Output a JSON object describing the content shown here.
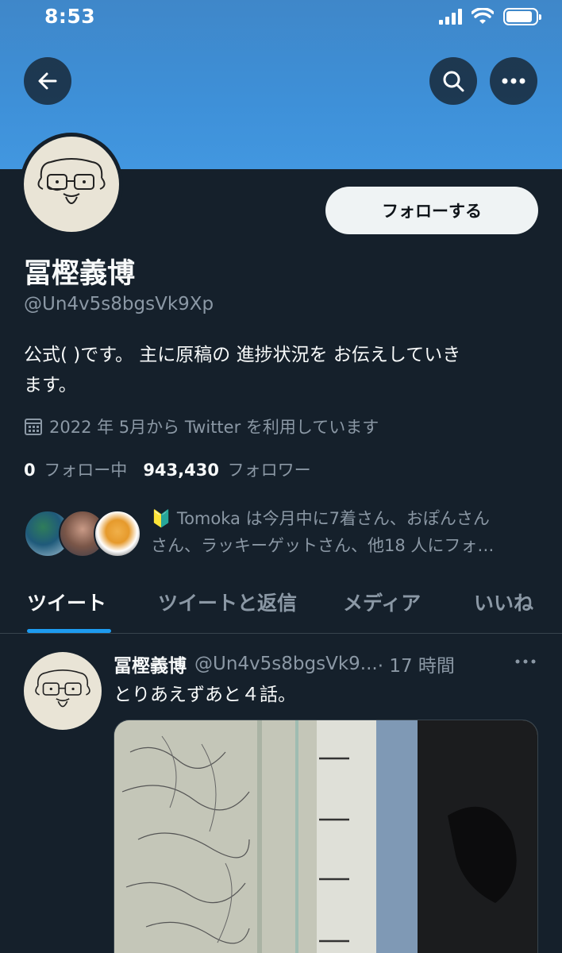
{
  "status_bar": {
    "time": "8:53",
    "battery_level": 0.9
  },
  "colors": {
    "background": "#15202b",
    "banner": "#3e90d8",
    "accent": "#1d9bf0",
    "secondary_text": "#8b98a5"
  },
  "header": {
    "back_icon": "arrow-left-icon",
    "search_icon": "search-icon",
    "more_icon": "more-horizontal-icon"
  },
  "profile": {
    "follow_label": "フォローする",
    "display_name": "冨樫義博",
    "handle": "@Un4v5s8bgsVk9Xp",
    "bio_line1": "公式( )です。 主に原稿の 進捗状況を お伝えしていき",
    "bio_line2": "ます。",
    "joined": "2022 年 5月から Twitter を利用しています",
    "following_count": "0",
    "following_label": "フォロー中",
    "followers_count": "943,430",
    "followers_label": "フォロワー"
  },
  "followers_you_know": {
    "line1": "🔰 Tomoka は今月中に7着さん、おぽんさん",
    "line2": "さん、ラッキーゲットさん、他18 人にフォ…"
  },
  "tabs": [
    {
      "label": "ツイート"
    },
    {
      "label": "ツイートと返信"
    },
    {
      "label": "メディア"
    },
    {
      "label": "いいね"
    }
  ],
  "tweet": {
    "name": "冨樫義博",
    "handle": "@Un4v5s8bgsVk9...",
    "time": "· 17 時間",
    "text": "とりあえずあと４話。"
  }
}
